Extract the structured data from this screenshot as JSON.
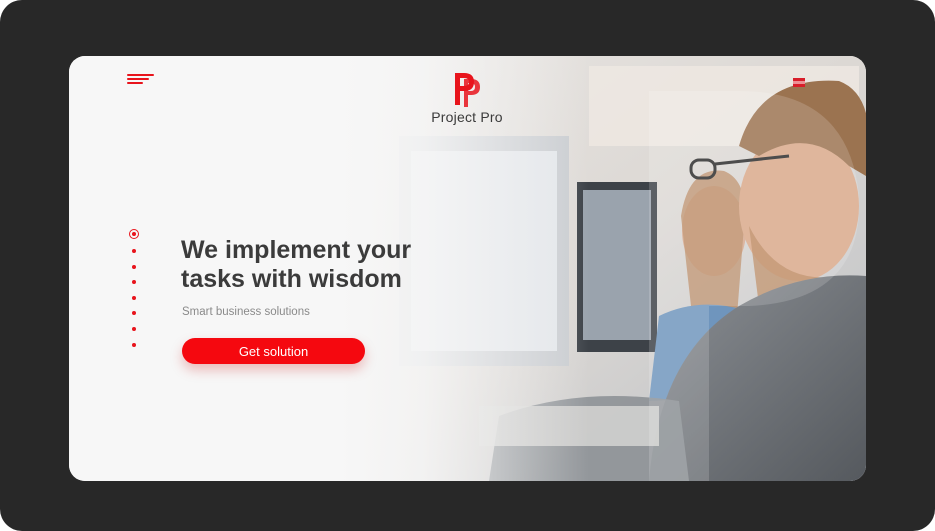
{
  "brand": {
    "name": "Project Pro",
    "accent": "#f5080f"
  },
  "hero": {
    "headline_line1": "We implement your",
    "headline_line2": "tasks with wisdom",
    "subtitle": "Smart business solutions",
    "cta_label": "Get solution"
  },
  "icons": {
    "menu": "hamburger-menu-icon",
    "language": "flag-icon",
    "logo": "pp-logo-icon"
  },
  "slider": {
    "total": 8,
    "active": 1
  },
  "colors": {
    "frame_bg": "#282828",
    "card_bg": "#f6f6f6",
    "text_dark": "#3b3b3b",
    "text_muted": "#8a8a8a"
  }
}
